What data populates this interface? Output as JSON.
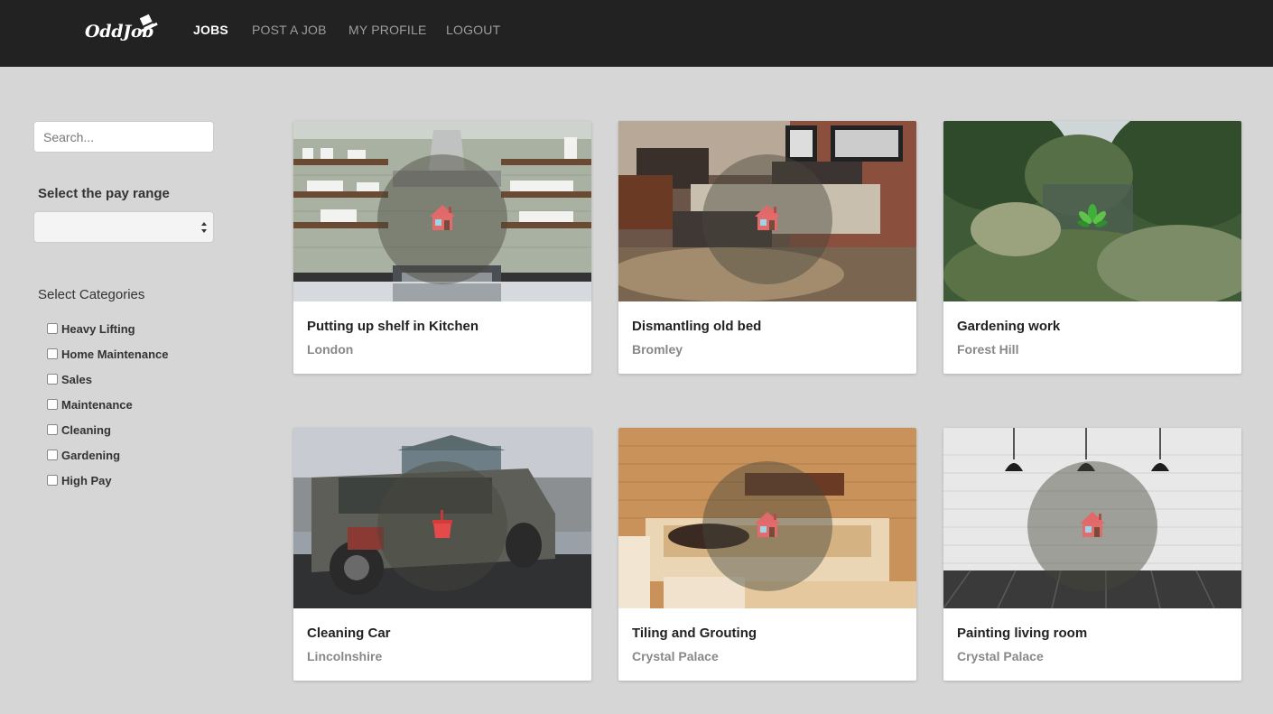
{
  "app": {
    "logo_text": "OddJob",
    "brand_color": "#222222"
  },
  "nav": {
    "items": [
      {
        "label": "JOBS",
        "active": true
      },
      {
        "label": "POST A JOB",
        "active": false
      },
      {
        "label": "MY PROFILE",
        "active": false
      },
      {
        "label": "LOGOUT",
        "active": false
      }
    ]
  },
  "sidebar": {
    "search_placeholder": "Search...",
    "pay_range_label": "Select the pay range",
    "pay_range_value": "",
    "categories_label": "Select Categories",
    "categories": [
      {
        "label": "Heavy Lifting",
        "checked": false
      },
      {
        "label": "Home Maintenance",
        "checked": false
      },
      {
        "label": "Sales",
        "checked": false
      },
      {
        "label": "Maintenance",
        "checked": false
      },
      {
        "label": "Cleaning",
        "checked": false
      },
      {
        "label": "Gardening",
        "checked": false
      },
      {
        "label": "High Pay",
        "checked": false
      }
    ]
  },
  "jobs": [
    {
      "title": "Putting up shelf in Kitchen",
      "location": "London",
      "icon": "house-icon",
      "image": "kitchen"
    },
    {
      "title": "Dismantling old bed",
      "location": "Bromley",
      "icon": "house-icon",
      "image": "bedroom"
    },
    {
      "title": "Gardening work",
      "location": "Forest Hill",
      "icon": "leaf-icon",
      "image": "garden"
    },
    {
      "title": "Cleaning Car",
      "location": "Lincolnshire",
      "icon": "bucket-icon",
      "image": "car"
    },
    {
      "title": "Tiling and Grouting",
      "location": "Crystal Palace",
      "icon": "house-icon",
      "image": "bathroom"
    },
    {
      "title": "Painting living room",
      "location": "Crystal Palace",
      "icon": "house-icon",
      "image": "brick-room"
    }
  ]
}
